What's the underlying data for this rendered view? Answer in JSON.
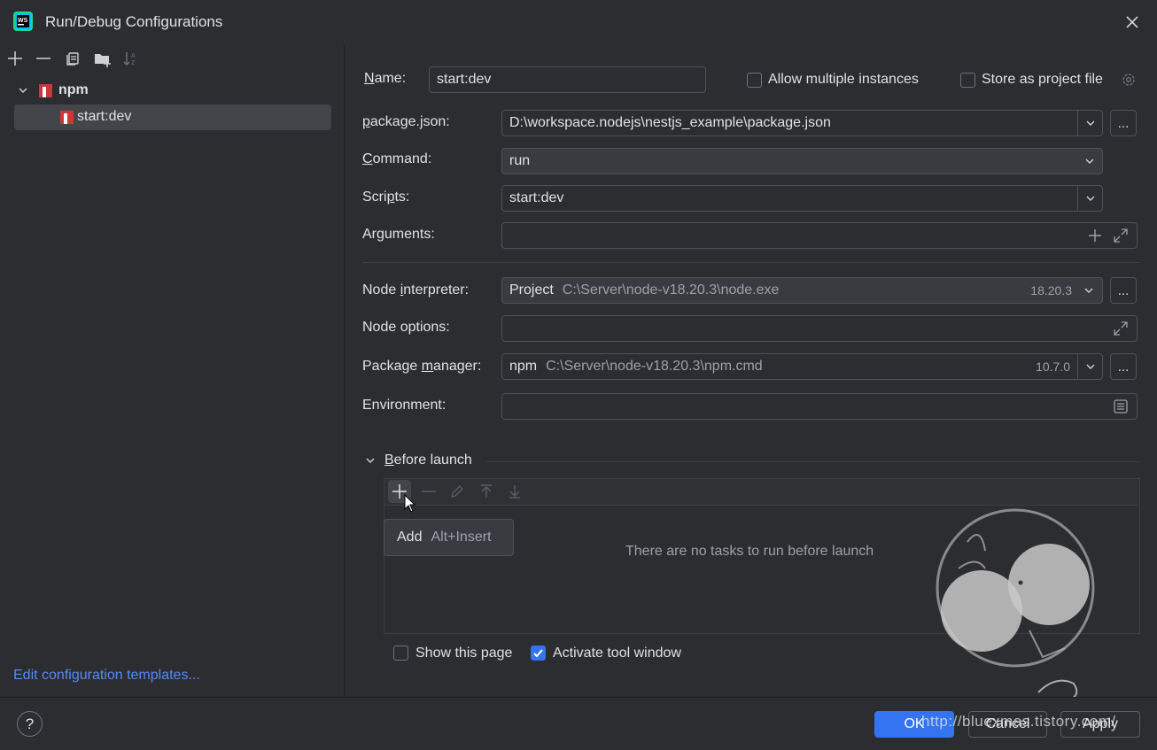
{
  "window": {
    "title": "Run/Debug Configurations"
  },
  "sidebar": {
    "tree": {
      "group_label": "npm",
      "item_label": "start:dev"
    },
    "templates_link": "Edit configuration templates..."
  },
  "form": {
    "name_label": "Name:",
    "name_value": "start:dev",
    "allow_multiple_label": "Allow multiple instances",
    "store_project_label": "Store as project file",
    "package_json_label": "package.json:",
    "package_json_value": "D:\\workspace.nodejs\\nestjs_example\\package.json",
    "command_label": "Command:",
    "command_value": "run",
    "scripts_label": "Scripts:",
    "scripts_value": "start:dev",
    "arguments_label": "Arguments:",
    "arguments_value": "",
    "node_interpreter_label": "Node interpreter:",
    "node_interpreter_kind": "Project",
    "node_interpreter_path": "C:\\Server\\node-v18.20.3\\node.exe",
    "node_interpreter_version": "18.20.3",
    "node_options_label": "Node options:",
    "node_options_value": "",
    "package_manager_label": "Package manager:",
    "package_manager_kind": "npm",
    "package_manager_path": "C:\\Server\\node-v18.20.3\\npm.cmd",
    "package_manager_version": "10.7.0",
    "environment_label": "Environment:",
    "environment_value": "",
    "dots": "..."
  },
  "before_launch": {
    "header": "Before launch",
    "empty_text": "There are no tasks to run before launch",
    "tooltip_label": "Add",
    "tooltip_shortcut": "Alt+Insert",
    "show_page_label": "Show this page",
    "activate_tool_label": "Activate tool window"
  },
  "buttons": {
    "ok": "OK",
    "cancel": "Cancel",
    "apply": "Apply",
    "help": "?"
  },
  "watermark": {
    "text": "http://bluexmas.tistory.com/"
  },
  "colors": {
    "accent": "#3574f0",
    "link": "#548af7",
    "background": "#2b2d30",
    "npm_red": "#cb3837"
  }
}
